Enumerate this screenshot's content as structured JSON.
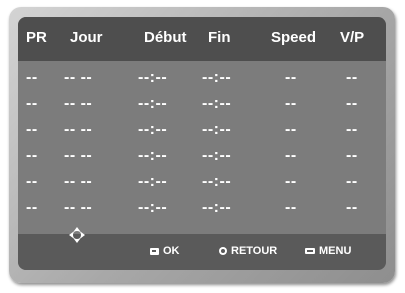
{
  "columns": [
    "PR",
    "Jour",
    "Début",
    "Fin",
    "Speed",
    "V/P"
  ],
  "rows": [
    {
      "pr": "--",
      "jour": "-- --",
      "debut": "--:--",
      "fin": "--:--",
      "speed": "--",
      "vp": "--"
    },
    {
      "pr": "--",
      "jour": "-- --",
      "debut": "--:--",
      "fin": "--:--",
      "speed": "--",
      "vp": "--"
    },
    {
      "pr": "--",
      "jour": "-- --",
      "debut": "--:--",
      "fin": "--:--",
      "speed": "--",
      "vp": "--"
    },
    {
      "pr": "--",
      "jour": "-- --",
      "debut": "--:--",
      "fin": "--:--",
      "speed": "--",
      "vp": "--"
    },
    {
      "pr": "--",
      "jour": "-- --",
      "debut": "--:--",
      "fin": "--:--",
      "speed": "--",
      "vp": "--"
    },
    {
      "pr": "--",
      "jour": "-- --",
      "debut": "--:--",
      "fin": "--:--",
      "speed": "--",
      "vp": "--"
    }
  ],
  "footer": {
    "navigate_icon": "dpad-icon",
    "ok_icon": "enter-icon",
    "ok_label": "OK",
    "return_icon": "return-icon",
    "return_label": "RETOUR",
    "menu_icon": "menu-icon",
    "menu_label": "MENU"
  },
  "colors": {
    "screen_background": "#7c7c7c",
    "header_background": "#4e4e4e",
    "footer_background": "#5a5a5a",
    "text": "#ffffff"
  }
}
